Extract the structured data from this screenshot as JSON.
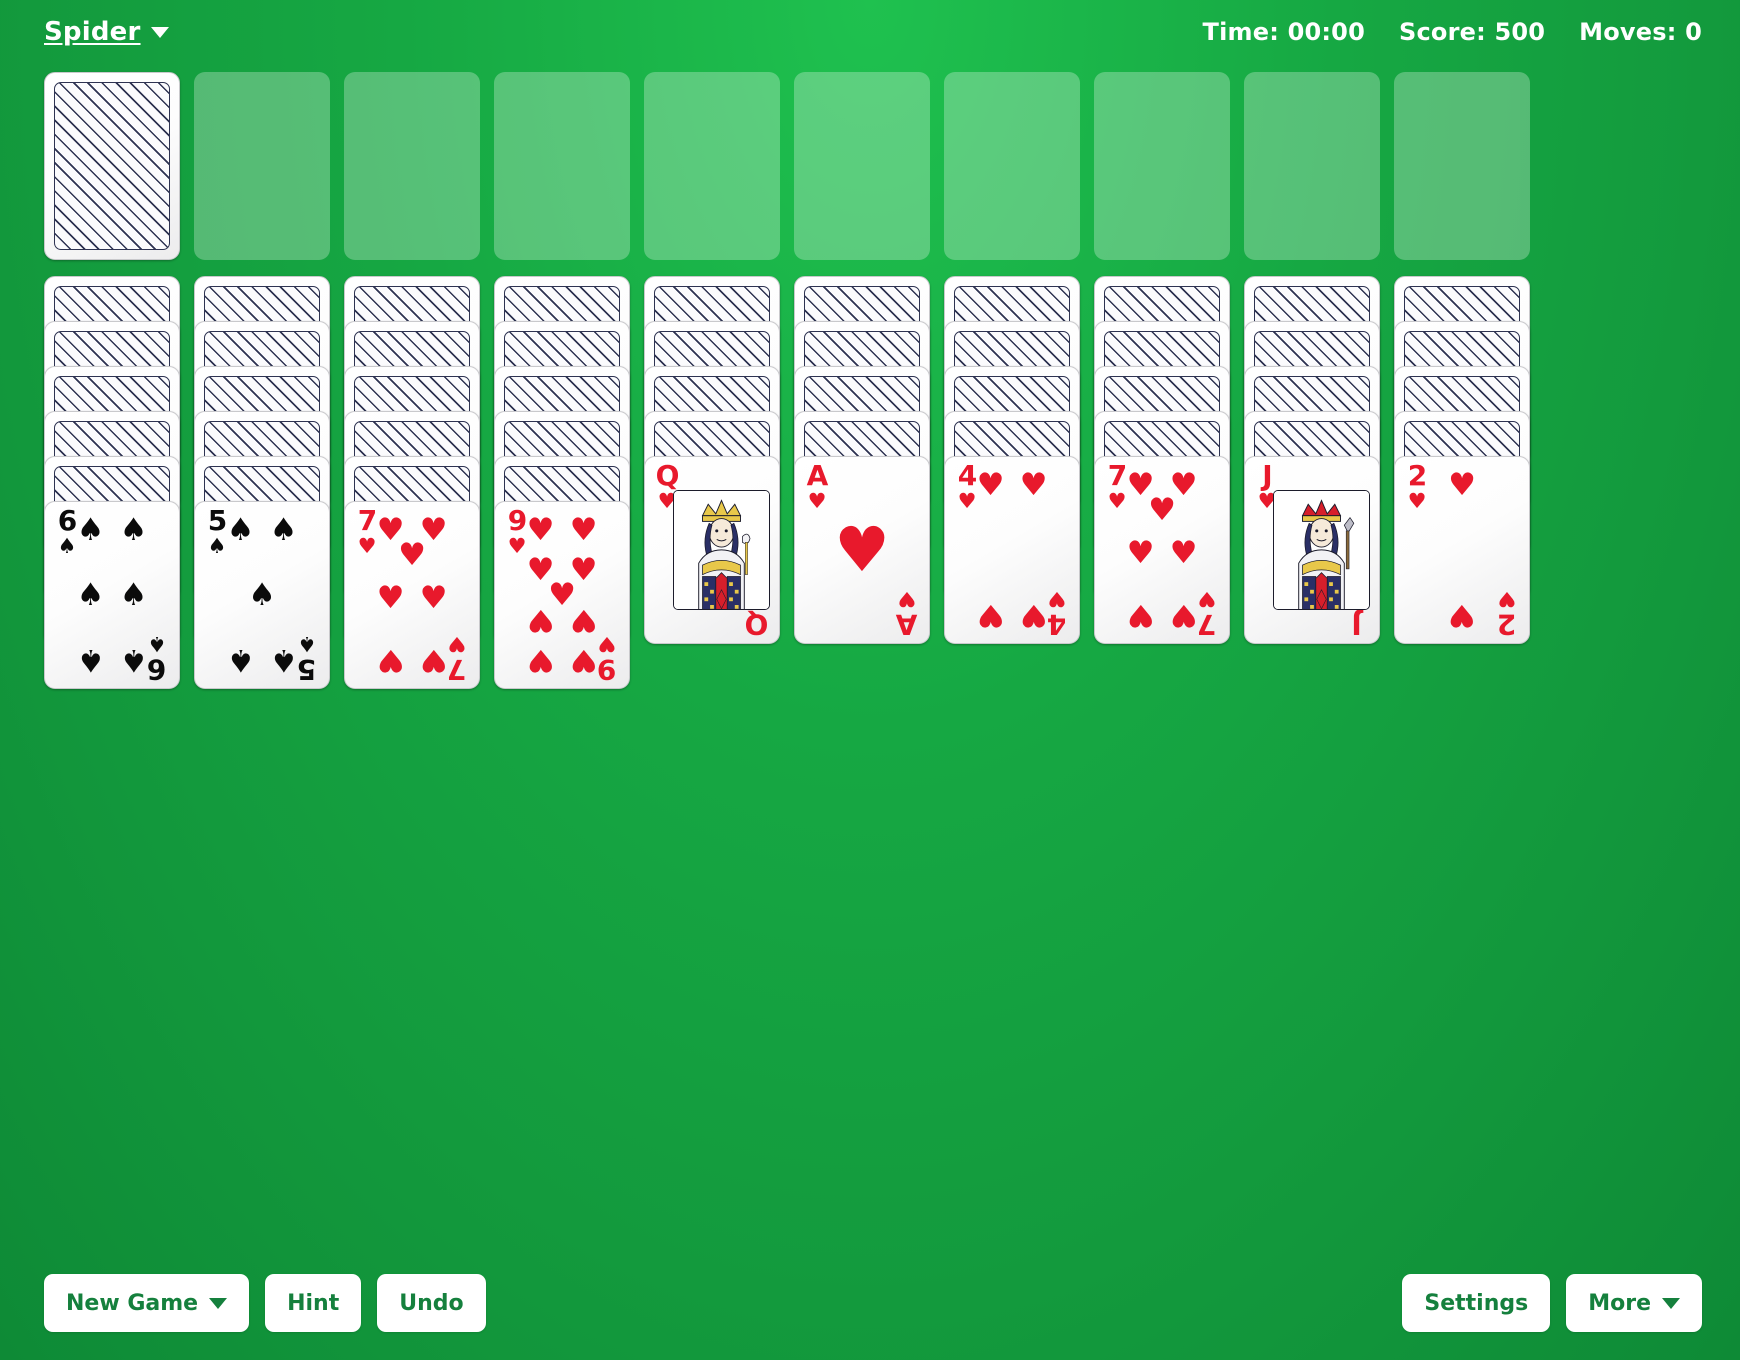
{
  "header": {
    "game_name": "Spider",
    "game_menu_icon": "chevron-down-icon",
    "time_label": "Time: 00:00",
    "score_label": "Score: 500",
    "moves_label": "Moves: 0"
  },
  "colors": {
    "felt_green": "#16a843",
    "felt_green_light": "#1fc14f",
    "slot_green": "#61cf7e",
    "card_white": "#ffffff",
    "red_suit": "#e8192c",
    "black_suit": "#0b0b0b",
    "card_back_ink": "#2e3352",
    "button_text_green": "#15803d"
  },
  "stock": {
    "name": "stock-pile",
    "face_down_count": 1
  },
  "foundations": [
    {
      "index": 0,
      "empty": true
    },
    {
      "index": 1,
      "empty": true
    },
    {
      "index": 2,
      "empty": true
    },
    {
      "index": 3,
      "empty": true
    },
    {
      "index": 4,
      "empty": true
    },
    {
      "index": 5,
      "empty": true
    },
    {
      "index": 6,
      "empty": true
    },
    {
      "index": 7,
      "empty": true
    },
    {
      "index": 8,
      "empty": true
    }
  ],
  "tableau": [
    {
      "column": 1,
      "face_down": 5,
      "face_up": [
        {
          "rank": "6",
          "suit": "spades",
          "color": "black",
          "pips": 6
        }
      ]
    },
    {
      "column": 2,
      "face_down": 5,
      "face_up": [
        {
          "rank": "5",
          "suit": "spades",
          "color": "black",
          "pips": 5
        }
      ]
    },
    {
      "column": 3,
      "face_down": 5,
      "face_up": [
        {
          "rank": "7",
          "suit": "hearts",
          "color": "red",
          "pips": 7
        }
      ]
    },
    {
      "column": 4,
      "face_down": 5,
      "face_up": [
        {
          "rank": "9",
          "suit": "hearts",
          "color": "red",
          "pips": 9
        }
      ]
    },
    {
      "column": 5,
      "face_down": 4,
      "face_up": [
        {
          "rank": "Q",
          "suit": "hearts",
          "color": "red",
          "court": true
        }
      ]
    },
    {
      "column": 6,
      "face_down": 4,
      "face_up": [
        {
          "rank": "A",
          "suit": "hearts",
          "color": "red",
          "pips": 1
        }
      ]
    },
    {
      "column": 7,
      "face_down": 4,
      "face_up": [
        {
          "rank": "4",
          "suit": "hearts",
          "color": "red",
          "pips": 4
        }
      ]
    },
    {
      "column": 8,
      "face_down": 4,
      "face_up": [
        {
          "rank": "7",
          "suit": "hearts",
          "color": "red",
          "pips": 7
        }
      ]
    },
    {
      "column": 9,
      "face_down": 4,
      "face_up": [
        {
          "rank": "J",
          "suit": "hearts",
          "color": "red",
          "court": true
        }
      ]
    },
    {
      "column": 10,
      "face_down": 4,
      "face_up": [
        {
          "rank": "2",
          "suit": "hearts",
          "color": "red",
          "pips": 2
        }
      ]
    }
  ],
  "suit_glyphs": {
    "spades": "♠",
    "hearts": "♥",
    "clubs": "♣",
    "diamonds": "♦"
  },
  "footer": {
    "new_game_label": "New Game",
    "new_game_icon": "chevron-down-icon",
    "hint_label": "Hint",
    "undo_label": "Undo",
    "settings_label": "Settings",
    "more_label": "More",
    "more_icon": "chevron-down-icon"
  }
}
